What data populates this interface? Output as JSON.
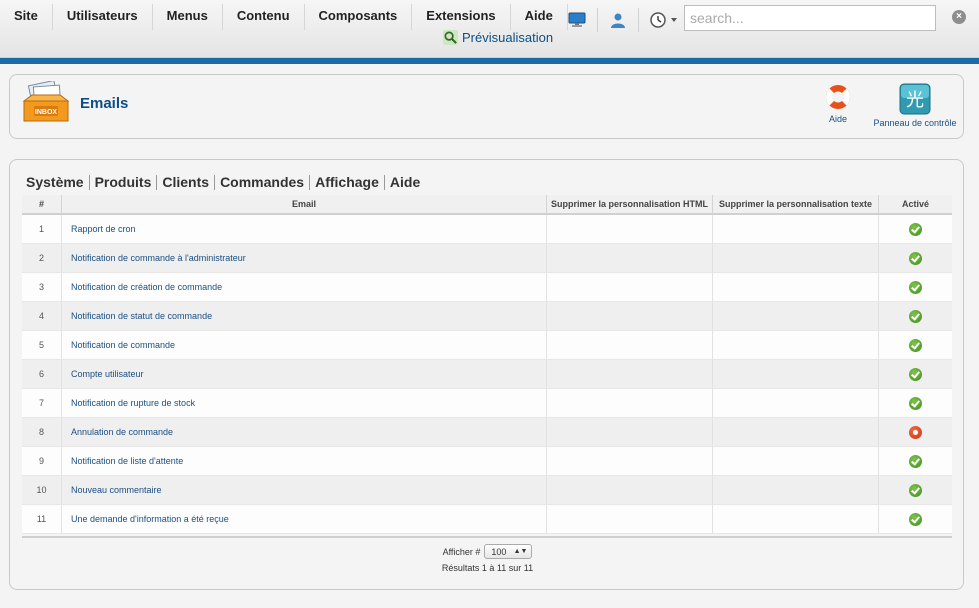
{
  "menu": {
    "items": [
      "Site",
      "Utilisateurs",
      "Menus",
      "Contenu",
      "Composants",
      "Extensions",
      "Aide"
    ],
    "preview_label": "Prévisualisation",
    "search_placeholder": "search..."
  },
  "header": {
    "title": "Emails",
    "help_label": "Aide",
    "cpanel_label": "Panneau de contrôle",
    "inbox_icon_text": "INBOX"
  },
  "subnav": [
    "Système",
    "Produits",
    "Clients",
    "Commandes",
    "Affichage",
    "Aide"
  ],
  "table": {
    "columns": [
      "#",
      "Email",
      "Supprimer la personnalisation HTML",
      "Supprimer la personnalisation texte",
      "Activé"
    ],
    "rows": [
      {
        "num": "1",
        "name": "Rapport de cron",
        "active": true
      },
      {
        "num": "2",
        "name": "Notification de commande à l'administrateur",
        "active": true
      },
      {
        "num": "3",
        "name": "Notification de création de commande",
        "active": true
      },
      {
        "num": "4",
        "name": "Notification de statut de commande",
        "active": true
      },
      {
        "num": "5",
        "name": "Notification de commande",
        "active": true
      },
      {
        "num": "6",
        "name": "Compte utilisateur",
        "active": true
      },
      {
        "num": "7",
        "name": "Notification de rupture de stock",
        "active": true
      },
      {
        "num": "8",
        "name": "Annulation de commande",
        "active": false
      },
      {
        "num": "9",
        "name": "Notification de liste d'attente",
        "active": true
      },
      {
        "num": "10",
        "name": "Nouveau commentaire",
        "active": true
      },
      {
        "num": "11",
        "name": "Une demande d'information a été reçue",
        "active": true
      }
    ]
  },
  "pager": {
    "limit_label": "Afficher #",
    "limit_value": "100",
    "results": "Résultats 1 à 11 sur 11"
  },
  "colors": {
    "accent": "#1a6ba8",
    "link": "#1b4f82",
    "active_green": "#4a9a25",
    "inactive_red": "#d84020"
  }
}
